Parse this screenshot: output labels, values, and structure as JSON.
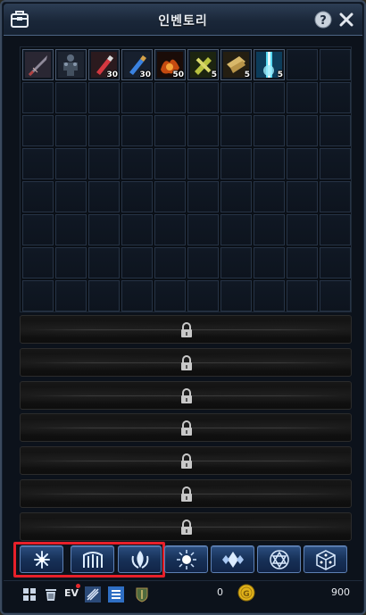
{
  "window": {
    "title": "인벤토리"
  },
  "inventory": {
    "items": [
      {
        "icon": "sword-icon",
        "qty": ""
      },
      {
        "icon": "armor-figure-icon",
        "qty": ""
      },
      {
        "icon": "red-potion-icon",
        "qty": "30"
      },
      {
        "icon": "blue-potion-icon",
        "qty": "30"
      },
      {
        "icon": "fire-orb-icon",
        "qty": "50"
      },
      {
        "icon": "scroll-yellow-icon",
        "qty": "5"
      },
      {
        "icon": "scroll-gold-icon",
        "qty": "5"
      },
      {
        "icon": "light-beam-icon",
        "qty": "5"
      }
    ],
    "locked_rows": 7
  },
  "filter_buttons": [
    {
      "icon": "snowflake-burst-icon"
    },
    {
      "icon": "gate-icon"
    },
    {
      "icon": "flame-leaf-icon"
    },
    {
      "icon": "sun-burst-icon"
    },
    {
      "icon": "diamonds-icon"
    },
    {
      "icon": "hexagram-icon"
    },
    {
      "icon": "dice-icon"
    }
  ],
  "bottom": {
    "ev_label": "EV",
    "count": "0",
    "money": "900"
  },
  "colors": {
    "title_bar": "#1a2739",
    "button_blue": "#173158",
    "highlight_red": "#e8202a",
    "coin_gold": "#e2b31a"
  }
}
